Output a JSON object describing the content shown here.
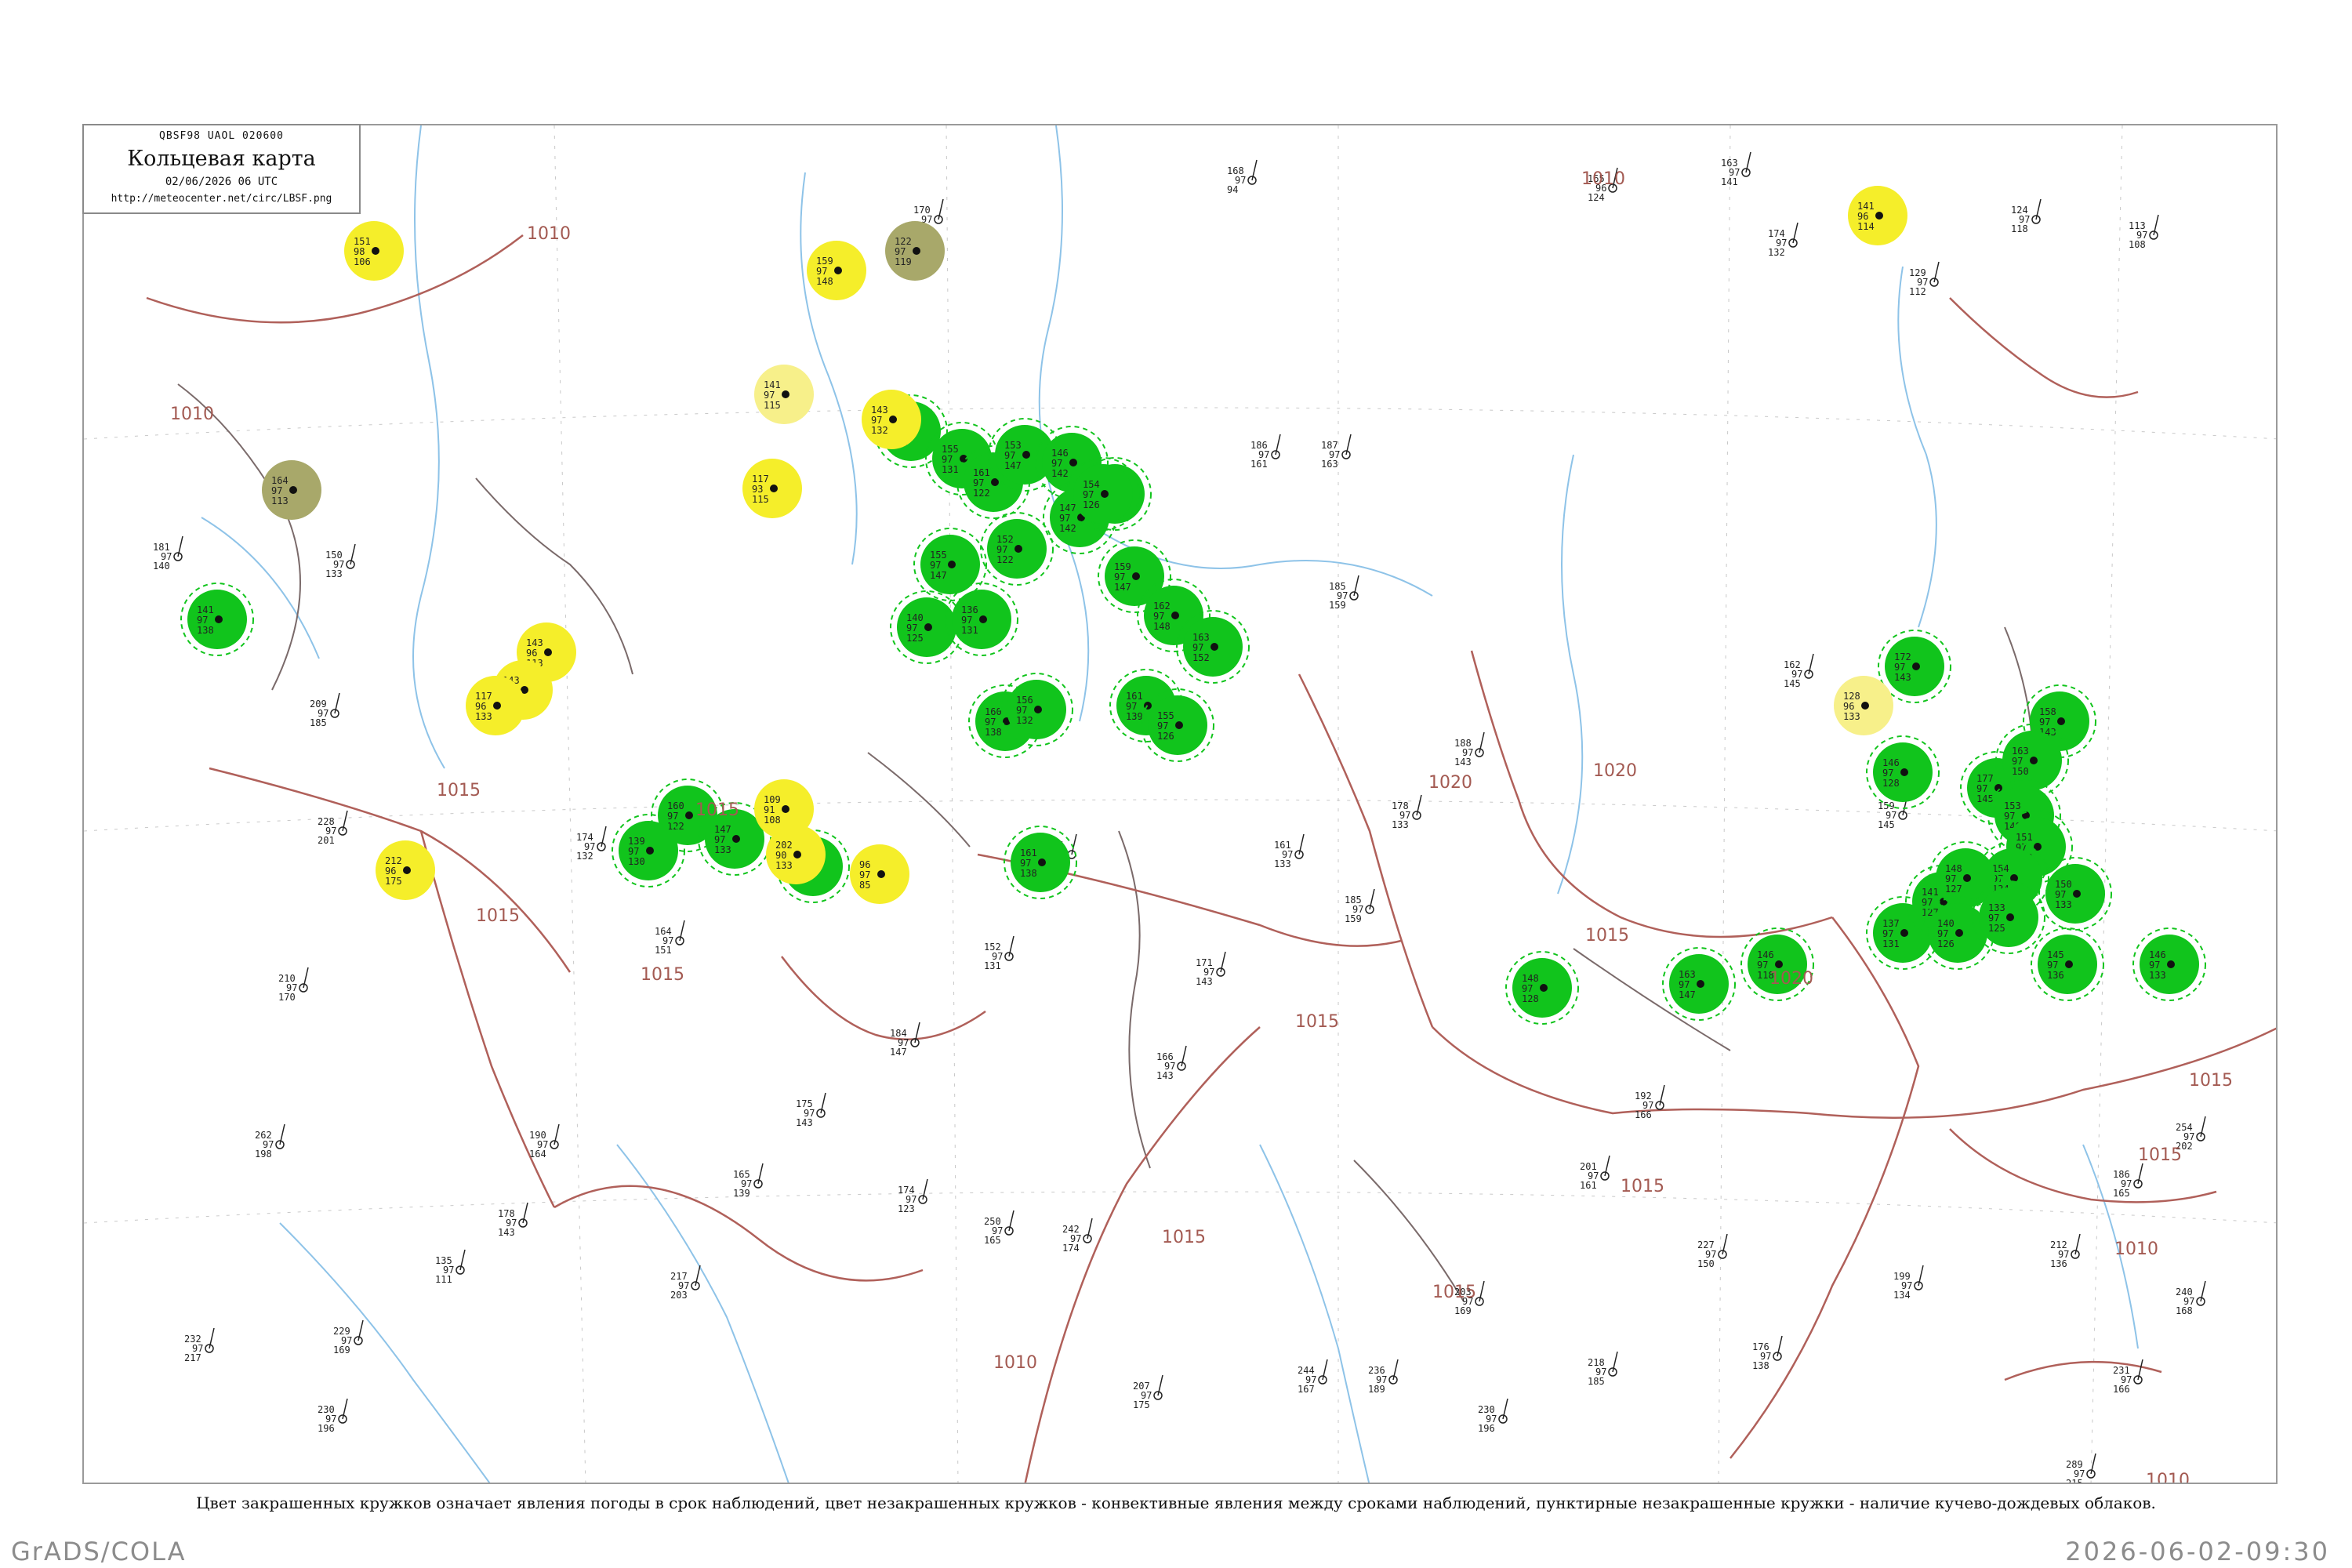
{
  "header": {
    "code": "QBSF98  UAOL  020600",
    "title": "Кольцевая карта",
    "datetime": "02/06/2026 06 UTC",
    "url": "http://meteocenter.net/circ/LBSF.png"
  },
  "caption": "Цвет закрашенных кружков означает явления погоды в срок наблюдений, цвет незакрашенных кружков - конвективные явления между сроками наблюдений, пунктирные незакрашенные кружки - наличие кучево-дождевых облаков.",
  "footer": {
    "left": "GrADS/COLA",
    "right": "2026-06-02-09:30"
  },
  "colors": {
    "thunderstorm_green": "#11c41c",
    "shower_yellow": "#f5ee2a",
    "pale_yellow": "#f7f08a",
    "haze_olive": "#a8a86a",
    "isobar_brown": "#b0605a",
    "river_blue": "#8ec3e8",
    "station_text": "#222222"
  },
  "map": {
    "isobar_labels": [
      {
        "text": "1010"
      },
      {
        "text": "1010"
      },
      {
        "text": "1010"
      },
      {
        "text": "1015"
      },
      {
        "text": "1015"
      },
      {
        "text": "1015"
      },
      {
        "text": "1015"
      },
      {
        "text": "1015"
      },
      {
        "text": "1015"
      },
      {
        "text": "1015"
      },
      {
        "text": "1020"
      },
      {
        "text": "1020"
      },
      {
        "text": "1020"
      },
      {
        "text": "1015"
      },
      {
        "text": "1010"
      },
      {
        "text": "1015"
      },
      {
        "text": "1015"
      },
      {
        "text": "1010"
      },
      {
        "text": "1010"
      },
      {
        "text": "1015"
      }
    ],
    "station_markers": [
      {
        "kind": "green",
        "label": [
          "141",
          "97",
          "138"
        ]
      },
      {
        "kind": "green",
        "label": [
          "160",
          "97",
          "131"
        ]
      },
      {
        "kind": "green",
        "label": [
          "155",
          "97",
          "131"
        ]
      },
      {
        "kind": "green",
        "label": [
          "161",
          "97",
          "122"
        ]
      },
      {
        "kind": "green",
        "label": [
          "153",
          "97",
          "147"
        ]
      },
      {
        "kind": "green",
        "label": [
          "146",
          "97",
          "142"
        ]
      },
      {
        "kind": "green",
        "label": [
          "152",
          "97",
          "122"
        ]
      },
      {
        "kind": "green",
        "label": [
          "147",
          "97",
          "142"
        ]
      },
      {
        "kind": "green",
        "label": [
          "148",
          "97",
          "134"
        ]
      },
      {
        "kind": "green",
        "label": [
          "155",
          "97",
          "147"
        ]
      },
      {
        "kind": "green",
        "label": [
          "140",
          "97",
          "125"
        ]
      },
      {
        "kind": "green",
        "label": [
          "136",
          "97",
          "131"
        ]
      },
      {
        "kind": "green",
        "label": [
          "159",
          "97",
          "147"
        ]
      },
      {
        "kind": "green",
        "label": [
          "162",
          "97",
          "148"
        ]
      },
      {
        "kind": "green",
        "label": [
          "163",
          "97",
          "152"
        ]
      },
      {
        "kind": "green",
        "label": [
          "161",
          "97",
          "139"
        ]
      },
      {
        "kind": "green",
        "label": [
          "155",
          "97",
          "126"
        ]
      },
      {
        "kind": "green",
        "label": [
          "160",
          "97",
          "138"
        ]
      },
      {
        "kind": "green",
        "label": [
          "156",
          "97",
          "132"
        ]
      },
      {
        "kind": "green",
        "label": [
          "160",
          "97",
          "122"
        ]
      },
      {
        "kind": "green",
        "label": [
          "147",
          "97",
          "133"
        ]
      },
      {
        "kind": "green",
        "label": [
          "146",
          "97",
          "128"
        ]
      },
      {
        "kind": "green",
        "label": [
          "139",
          "97",
          "130"
        ]
      },
      {
        "kind": "green",
        "label": [
          "148",
          "97",
          "128"
        ]
      },
      {
        "kind": "green",
        "label": [
          "163",
          "97",
          "147"
        ]
      },
      {
        "kind": "green",
        "label": [
          "146",
          "97",
          "118"
        ]
      },
      {
        "kind": "green",
        "label": [
          "137",
          "97",
          "131"
        ]
      },
      {
        "kind": "green",
        "label": [
          "141",
          "97",
          "127"
        ]
      },
      {
        "kind": "green",
        "label": [
          "146",
          "97",
          "128"
        ]
      },
      {
        "kind": "green",
        "label": [
          "177",
          "97",
          "145"
        ]
      },
      {
        "kind": "green",
        "label": [
          "172",
          "97",
          "143"
        ]
      },
      {
        "kind": "green",
        "label": [
          "158",
          "97",
          "143"
        ]
      },
      {
        "kind": "green",
        "label": [
          "163",
          "97",
          "150"
        ]
      },
      {
        "kind": "green",
        "label": [
          "153",
          "97",
          "140"
        ]
      },
      {
        "kind": "green",
        "label": [
          "151",
          "97",
          "143"
        ]
      },
      {
        "kind": "green",
        "label": [
          "154",
          "97",
          "134"
        ]
      },
      {
        "kind": "green",
        "label": [
          "148",
          "97",
          "127"
        ]
      },
      {
        "kind": "green",
        "label": [
          "150",
          "97",
          "133"
        ]
      },
      {
        "kind": "green",
        "label": [
          "145",
          "97",
          "136"
        ]
      },
      {
        "kind": "green",
        "label": [
          "146",
          "97",
          "133"
        ]
      },
      {
        "kind": "green",
        "label": [
          "140",
          "97",
          "126"
        ]
      },
      {
        "kind": "green",
        "label": [
          "133",
          "97",
          "125"
        ]
      },
      {
        "kind": "green",
        "label": [
          "161",
          "97",
          "138"
        ]
      },
      {
        "kind": "green",
        "label": [
          "154",
          "97",
          "126"
        ]
      },
      {
        "kind": "yellow",
        "label": [
          "151",
          "98",
          "106"
        ]
      },
      {
        "kind": "yellow",
        "label": [
          "159",
          "97",
          "148"
        ]
      },
      {
        "kind": "yellow",
        "label": [
          "143",
          "97",
          "132"
        ]
      },
      {
        "kind": "yellow",
        "label": [
          "117",
          "93",
          "115"
        ]
      },
      {
        "kind": "yellow",
        "label": [
          "143",
          "96",
          "113"
        ]
      },
      {
        "kind": "yellow",
        "label": [
          "143",
          "97",
          "133"
        ]
      },
      {
        "kind": "yellow",
        "label": [
          "117",
          "96",
          "133"
        ]
      },
      {
        "kind": "yellow",
        "label": [
          "109",
          "91",
          "108"
        ]
      },
      {
        "kind": "yellow",
        "label": [
          "202",
          "90",
          "133"
        ]
      },
      {
        "kind": "yellow",
        "label": [
          "96",
          "97",
          "85"
        ]
      },
      {
        "kind": "yellow",
        "label": [
          "212",
          "96",
          "175"
        ]
      },
      {
        "kind": "yellow",
        "label": [
          "141",
          "96",
          "114"
        ]
      },
      {
        "kind": "paleyellow",
        "label": [
          "141",
          "97",
          "115"
        ]
      },
      {
        "kind": "paleyellow",
        "label": [
          "128",
          "96",
          "133"
        ]
      },
      {
        "kind": "olive",
        "label": [
          "122",
          "97",
          "119"
        ]
      },
      {
        "kind": "olive",
        "label": [
          "164",
          "97",
          "113"
        ]
      }
    ],
    "sample_stations": [
      {
        "p": "170",
        "d": "97",
        "t": "147"
      },
      {
        "p": "168",
        "d": "97",
        "t": "94"
      },
      {
        "p": "165",
        "d": "96",
        "t": "124"
      },
      {
        "p": "174",
        "d": "97",
        "t": "132"
      },
      {
        "p": "186",
        "d": "97",
        "t": "161"
      },
      {
        "p": "187",
        "d": "97",
        "t": "163"
      },
      {
        "p": "185",
        "d": "97",
        "t": "159"
      },
      {
        "p": "163",
        "d": "97",
        "t": "141"
      },
      {
        "p": "181",
        "d": "97",
        "t": "140"
      },
      {
        "p": "150",
        "d": "97",
        "t": "133"
      },
      {
        "p": "209",
        "d": "97",
        "t": "185"
      },
      {
        "p": "228",
        "d": "97",
        "t": "201"
      },
      {
        "p": "210",
        "d": "97",
        "t": "170"
      },
      {
        "p": "262",
        "d": "97",
        "t": "198"
      },
      {
        "p": "232",
        "d": "97",
        "t": "217"
      },
      {
        "p": "229",
        "d": "97",
        "t": "169"
      },
      {
        "p": "230",
        "d": "97",
        "t": "196"
      },
      {
        "p": "217",
        "d": "97",
        "t": "203"
      },
      {
        "p": "174",
        "d": "97",
        "t": "123"
      },
      {
        "p": "250",
        "d": "97",
        "t": "165"
      },
      {
        "p": "242",
        "d": "97",
        "t": "174"
      },
      {
        "p": "207",
        "d": "97",
        "t": "175"
      },
      {
        "p": "244",
        "d": "97",
        "t": "167"
      },
      {
        "p": "236",
        "d": "97",
        "t": "189"
      },
      {
        "p": "203",
        "d": "97",
        "t": "169"
      },
      {
        "p": "230",
        "d": "97",
        "t": "196"
      },
      {
        "p": "218",
        "d": "97",
        "t": "185"
      },
      {
        "p": "201",
        "d": "97",
        "t": "161"
      },
      {
        "p": "227",
        "d": "97",
        "t": "150"
      },
      {
        "p": "176",
        "d": "97",
        "t": "138"
      },
      {
        "p": "199",
        "d": "97",
        "t": "134"
      },
      {
        "p": "212",
        "d": "97",
        "t": "136"
      },
      {
        "p": "231",
        "d": "97",
        "t": "166"
      },
      {
        "p": "240",
        "d": "97",
        "t": "168"
      },
      {
        "p": "289",
        "d": "97",
        "t": "215"
      },
      {
        "p": "254",
        "d": "97",
        "t": "202"
      },
      {
        "p": "186",
        "d": "97",
        "t": "165"
      },
      {
        "p": "192",
        "d": "97",
        "t": "166"
      },
      {
        "p": "183",
        "d": "97",
        "t": "152"
      },
      {
        "p": "159",
        "d": "97",
        "t": "145"
      },
      {
        "p": "129",
        "d": "97",
        "t": "112"
      },
      {
        "p": "124",
        "d": "97",
        "t": "118"
      },
      {
        "p": "113",
        "d": "97",
        "t": "108"
      },
      {
        "p": "162",
        "d": "97",
        "t": "145"
      },
      {
        "p": "188",
        "d": "97",
        "t": "143"
      },
      {
        "p": "178",
        "d": "97",
        "t": "133"
      },
      {
        "p": "185",
        "d": "97",
        "t": "159"
      },
      {
        "p": "161",
        "d": "97",
        "t": "133"
      },
      {
        "p": "171",
        "d": "97",
        "t": "143"
      },
      {
        "p": "166",
        "d": "97",
        "t": "143"
      },
      {
        "p": "136",
        "d": "97",
        "t": "121"
      },
      {
        "p": "152",
        "d": "97",
        "t": "131"
      },
      {
        "p": "184",
        "d": "97",
        "t": "147"
      },
      {
        "p": "175",
        "d": "97",
        "t": "143"
      },
      {
        "p": "165",
        "d": "97",
        "t": "139"
      },
      {
        "p": "190",
        "d": "97",
        "t": "164"
      },
      {
        "p": "178",
        "d": "97",
        "t": "143"
      },
      {
        "p": "135",
        "d": "97",
        "t": "111"
      },
      {
        "p": "164",
        "d": "97",
        "t": "151"
      },
      {
        "p": "174",
        "d": "97",
        "t": "132"
      }
    ]
  }
}
